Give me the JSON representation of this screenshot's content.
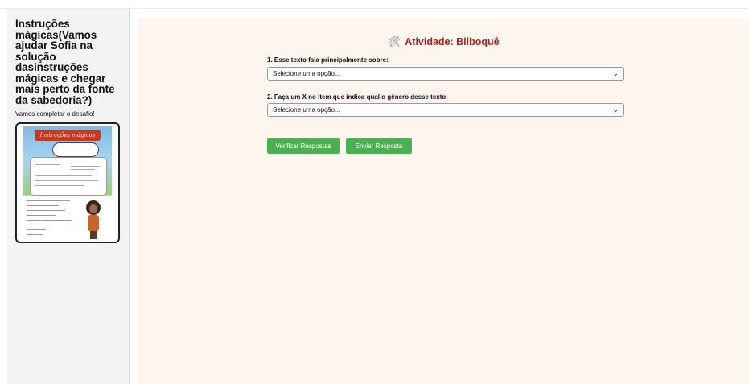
{
  "sidebar": {
    "title": "Instruções mágicas(Vamos ajudar Sofia na solução dasinstruções mágicas e chegar mais perto da fonte da sabedoria?)",
    "subtitle": "Vamos completar o desafio!",
    "thumbnail": {
      "banner_text": "Instruções mágicas"
    }
  },
  "main": {
    "title_icon": "🛠",
    "title": "Atividade: Bilboquê",
    "questions": [
      {
        "label": "1. Esse texto fala principalmente sobre:",
        "selected": "Selecione uma opção..."
      },
      {
        "label": "2. Faça um X no item que indica qual o gênero desse texto:",
        "selected": "Selecione uma opção..."
      }
    ],
    "buttons": {
      "verify": "Verificar Respostas",
      "submit": "Enviar Resposta"
    }
  },
  "colors": {
    "accent_green": "#4caf50",
    "title_red": "#b0201b",
    "main_bg": "#fdf6ee",
    "sidebar_bg": "#f3f3f3"
  },
  "icons": {
    "title": "tools-icon",
    "select": "chevron-down-icon"
  }
}
